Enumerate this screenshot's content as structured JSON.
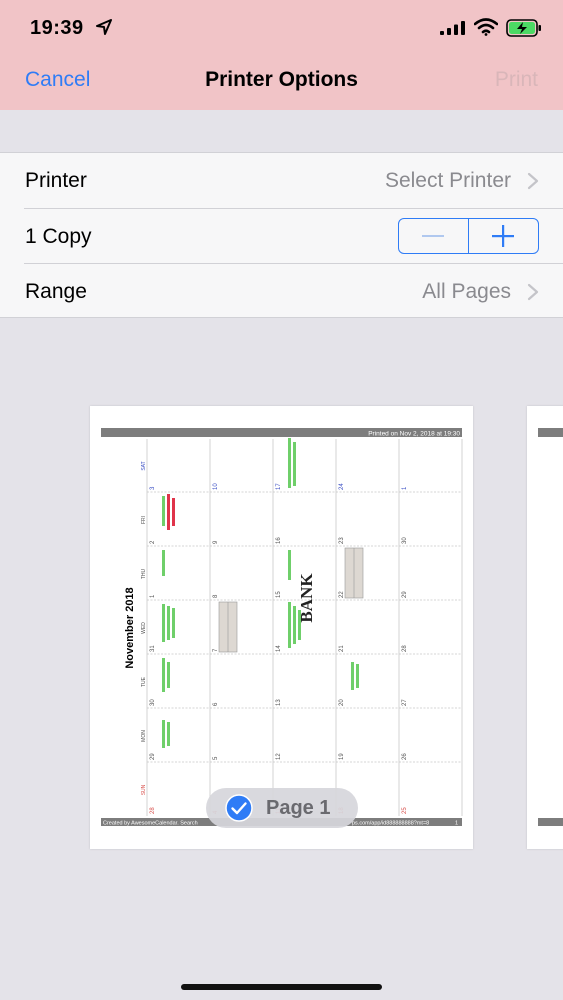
{
  "status_bar": {
    "time": "19:39",
    "location_icon": "location-arrow-icon",
    "signal_icon": "cellular-signal-icon",
    "wifi_icon": "wifi-icon",
    "battery_icon": "battery-charging-icon",
    "battery_color": "#4cd964"
  },
  "nav": {
    "cancel_label": "Cancel",
    "title": "Printer Options",
    "print_label": "Print"
  },
  "options": {
    "printer": {
      "label": "Printer",
      "value": "Select Printer"
    },
    "copies": {
      "label": "1 Copy",
      "minus_icon": "minus-icon",
      "plus_icon": "plus-icon"
    },
    "range": {
      "label": "Range",
      "value": "All Pages"
    }
  },
  "preview": {
    "printed_on": "Printed on Nov 2, 2018 at 19:30",
    "month_title": "November 2018",
    "weekdays": [
      "SAT",
      "FRI",
      "THU",
      "WED",
      "TUE",
      "MON",
      "SUN"
    ],
    "week_days": [
      [
        "3",
        "2",
        "1",
        "31",
        "30",
        "29",
        "28"
      ],
      [
        "10",
        "9",
        "8",
        "7",
        "6",
        "5",
        "4"
      ],
      [
        "17",
        "16",
        "15",
        "14",
        "13",
        "12",
        "11"
      ],
      [
        "24",
        "23",
        "22",
        "21",
        "20",
        "19",
        "18"
      ],
      [
        "1",
        "30",
        "29",
        "28",
        "27",
        "26",
        "25"
      ]
    ],
    "watermark": "BANK",
    "footer_left": "Created by AwesomeCalendar. Search",
    "footer_right": "ps.com/app/id888888888?mt=8",
    "footer_page": "1",
    "page_label": "Page 1",
    "page_check_icon": "checkmark-circle-icon",
    "colors": {
      "header_bar": "#7d7d7d",
      "saturday": "#3b4fc4",
      "sunday": "#d9534f",
      "event_green": "#6fcf6a",
      "event_red": "#e0344a"
    }
  },
  "colors": {
    "accent": "#2f7cf6",
    "nav_background": "#f1c4c7",
    "disabled_print": "#d9b6b9"
  }
}
